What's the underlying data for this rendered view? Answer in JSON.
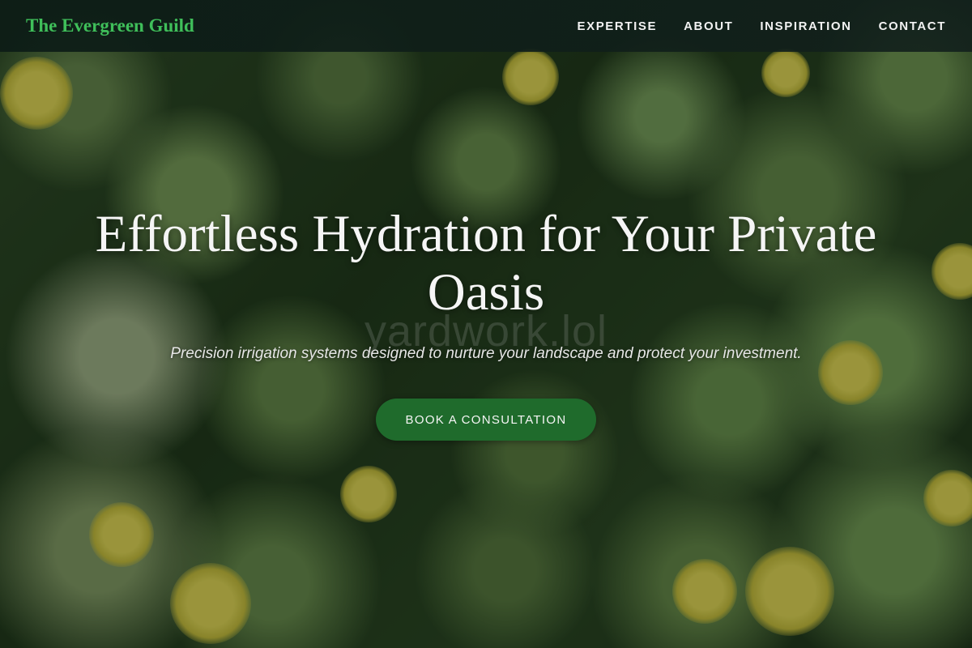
{
  "header": {
    "brand": "The Evergreen Guild",
    "nav": [
      "EXPERTISE",
      "ABOUT",
      "INSPIRATION",
      "CONTACT"
    ]
  },
  "hero": {
    "title": "Effortless Hydration for Your Private Oasis",
    "watermark": "yardwork.lol",
    "subtitle": "Precision irrigation systems designed to nurture your landscape and protect your investment.",
    "cta_label": "BOOK A CONSULTATION"
  },
  "colors": {
    "brand": "#3fbf5a",
    "cta_background": "#1f6b2c",
    "header_background": "#0f1f1a"
  }
}
